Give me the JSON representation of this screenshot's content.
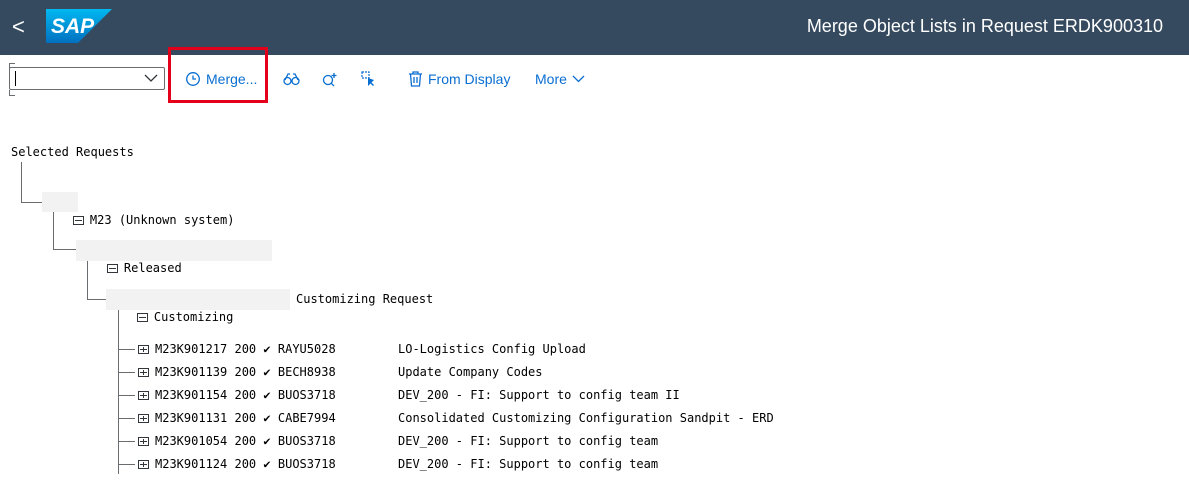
{
  "header": {
    "back_label": "<",
    "logo_text": "SAP",
    "title": "Merge Object Lists in Request ERDK900310"
  },
  "toolbar": {
    "command_value": "",
    "merge_label": "Merge...",
    "from_display_label": "From Display",
    "more_label": "More"
  },
  "tree": {
    "root_label": "Selected Requests",
    "system_id": "M23",
    "system_desc": "(Unknown system)",
    "status_label": "Released",
    "type_label": "Customizing",
    "type_desc": "Customizing Request",
    "requests": [
      {
        "id": "M23K901217",
        "client": "200",
        "check": "✔",
        "owner": "RAYU5028",
        "desc": "LO-Logistics Config Upload"
      },
      {
        "id": "M23K901139",
        "client": "200",
        "check": "✔",
        "owner": "BECH8938",
        "desc": "Update Company Codes"
      },
      {
        "id": "M23K901154",
        "client": "200",
        "check": "✔",
        "owner": "BUOS3718",
        "desc": "DEV_200 - FI: Support to config team II"
      },
      {
        "id": "M23K901131",
        "client": "200",
        "check": "✔",
        "owner": "CABE7994",
        "desc": "Consolidated Customizing Configuration Sandpit - ERD"
      },
      {
        "id": "M23K901054",
        "client": "200",
        "check": "✔",
        "owner": "BUOS3718",
        "desc": "DEV_200 - FI: Support to config team"
      },
      {
        "id": "M23K901124",
        "client": "200",
        "check": "✔",
        "owner": "BUOS3718",
        "desc": "DEV_200 - FI: Support to config team"
      }
    ]
  },
  "colors": {
    "shell": "#354a5f",
    "link": "#0a6ed1",
    "highlight": "#e4001b"
  }
}
